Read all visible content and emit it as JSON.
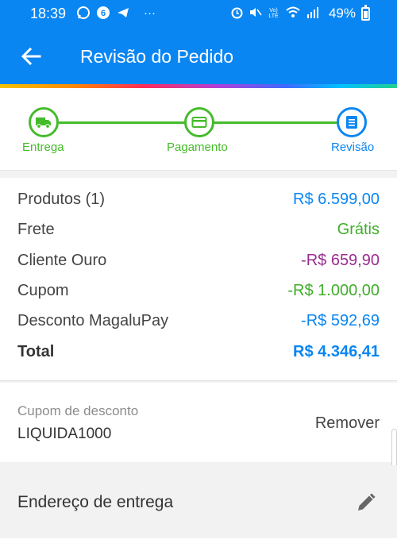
{
  "status_bar": {
    "time": "18:39",
    "battery": "49%",
    "left_icons": [
      "whatsapp-icon",
      "b-app-icon",
      "telegram-icon",
      "more-dots-icon"
    ],
    "right_icons": [
      "alarm-icon",
      "mute-icon",
      "volte-icon",
      "wifi-icon",
      "signal-icon",
      "battery-icon"
    ]
  },
  "app_bar": {
    "title": "Revisão do Pedido",
    "back_icon": "arrow-back-icon"
  },
  "stepper": {
    "steps": [
      {
        "label": "Entrega",
        "icon": "truck-icon",
        "state": "done"
      },
      {
        "label": "Pagamento",
        "icon": "card-icon",
        "state": "done"
      },
      {
        "label": "Revisão",
        "icon": "list-icon",
        "state": "current"
      }
    ],
    "colors": {
      "done": "#44bb2a",
      "current": "#0a86f2"
    }
  },
  "summary": {
    "rows": [
      {
        "label": "Produtos (1)",
        "value": "R$ 6.599,00"
      },
      {
        "label": "Frete",
        "value": "Grátis"
      },
      {
        "label": "Cliente Ouro",
        "value": "-R$ 659,90"
      },
      {
        "label": "Cupom",
        "value": "-R$ 1.000,00"
      },
      {
        "label": "Desconto MagaluPay",
        "value": "-R$ 592,69"
      },
      {
        "label": "Total",
        "value": "R$ 4.346,41"
      }
    ]
  },
  "coupon": {
    "caption": "Cupom de desconto",
    "code": "LIQUIDA1000",
    "remove_label": "Remover"
  },
  "address": {
    "title": "Endereço de entrega",
    "edit_icon": "pencil-icon"
  },
  "colors": {
    "brand_blue": "#0a86f2",
    "success_green": "#44bb2a",
    "discount_purple": "#9b2c8f"
  }
}
